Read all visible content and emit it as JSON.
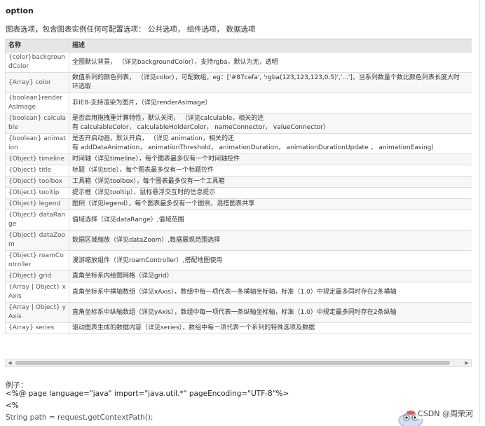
{
  "title": "option",
  "intro": "图表选项，包含图表实例任何可配置选项： 公共选项， 组件选项， 数据选项",
  "table": {
    "headers": [
      "名称",
      "描述"
    ],
    "rows": [
      {
        "name": "{color}backgroundColor",
        "desc": "全图默认背景， （详见backgroundColor），支持rgba，默认为无，透明"
      },
      {
        "name": "{Array} color",
        "desc": "数值系列的颜色列表， （详见color），可配数组，eg：['#87cefa', 'rgba(123,123,123,0.5)','...']，当系列数量个数比颜色列表长度大时",
        "desc2": "环选取"
      },
      {
        "name": "{boolean}renderAsImage",
        "desc": "非IE8-支持渲染为图片，（详见renderAsImage）"
      },
      {
        "name": "{boolean} calculable",
        "desc": "是否启用拖拽重计算特性，默认关闭， （详见calculable，相关的还",
        "desc2": "有 calculableColor， calculableHolderColor， nameConnector， valueConnector）"
      },
      {
        "name": "{boolean} animation",
        "desc": "是否开启动画，默认开启， （详见 animation，相关的还",
        "desc2": "有 addDataAnimation， animationThreshold， animationDuration， animationDurationUpdate ， animationEasing）"
      },
      {
        "name": "{Object} timeline",
        "desc": "时间轴（详见timeline），每个图表最多仅有一个时间轴控件"
      },
      {
        "name": "{Object} title",
        "desc": "标题（详见title），每个图表最多仅有一个标题控件"
      },
      {
        "name": "{Object} toolbox",
        "desc": "工具箱（详见toolbox），每个图表最多仅有一个工具箱"
      },
      {
        "name": "{Object} tooltip",
        "desc": "提示框（详见tooltip），鼠标悬浮交互时的信息提示"
      },
      {
        "name": "{Object} legend",
        "desc": "图例（详见legend），每个图表最多仅有一个图例，混搭图表共享"
      },
      {
        "name": "{Object} dataRange",
        "desc": "值域选择（详见dataRange）,值域范围"
      },
      {
        "name": "{Object} dataZoom",
        "desc": "数据区域缩放（详见dataZoom）,数据展现范围选择"
      },
      {
        "name": "{Object} roamController",
        "desc": "漫游缩放组件（详见roamController）,搭配地图使用"
      },
      {
        "name": "{Object} grid",
        "desc": "直角坐标系内绘图网格（详见grid）"
      },
      {
        "name": "{Array | Object} xAxis",
        "desc": "直角坐标系中横轴数组（详见xAxis），数组中每一项代表一条横轴坐标轴，标准（1.0）中规定最多同时存在2条横轴"
      },
      {
        "name": "{Array | Object} yAxis",
        "desc": "直角坐标系中纵轴数组（详见yAxis），数组中每一项代表一条纵轴坐标轴，标准（1.0）中规定最多同时存在2条纵轴"
      },
      {
        "name": "{Array} series",
        "desc": "驱动图表生成的数据内容（详见series），数组中每一项代表一个系列的特殊选项及数据"
      }
    ]
  },
  "example": {
    "label": "例子：",
    "lines": [
      "<%@ page language=\"java\" import=\"java.util.*\" pageEncoding=\"UTF-8\"%>",
      "<%",
      "String path = request.getContextPath();"
    ]
  },
  "watermark": "CSDN @周荣河"
}
